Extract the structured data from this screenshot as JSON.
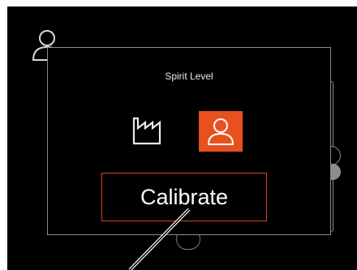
{
  "dialog": {
    "title": "Spirit Level",
    "calibrate_label": "Calibrate"
  },
  "modes": [
    {
      "icon": "factory-icon",
      "selected": false
    },
    {
      "icon": "user-icon",
      "selected": true
    }
  ],
  "colors": {
    "accent": "#e8501e",
    "screen_background": "#000000",
    "border": "#8b8b8b"
  }
}
